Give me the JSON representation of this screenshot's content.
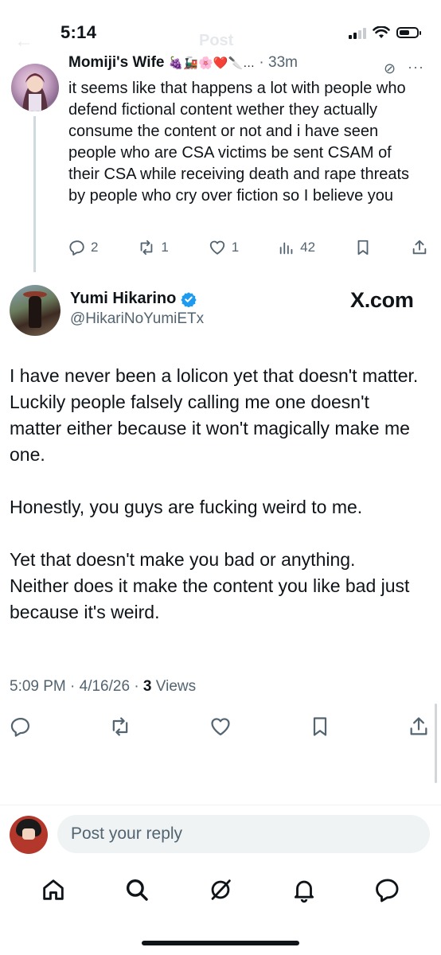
{
  "status_bar": {
    "time": "5:14"
  },
  "header": {
    "title": "Post"
  },
  "parent_tweet": {
    "display_name": "Momiji's Wife",
    "emojis": "🍇🚂🌸❤️🔪…",
    "time": "· 33m",
    "text": "it seems like that happens a lot with people who defend fictional content wether they actually consume the content or not and i have seen people who are CSA victims be sent CSAM of their CSA while receiving death and rape threats by people who cry over fiction so I believe you",
    "replies": "2",
    "reposts": "1",
    "likes": "1",
    "views": "42"
  },
  "main_tweet": {
    "display_name": "Yumi Hikarino",
    "handle": "@HikariNoYumiETx",
    "watermark": "X.com",
    "text": "I have never been a lolicon yet that doesn't matter.\nLuckily people falsely calling me one doesn't matter either because it won't magically make me one.\n\nHonestly, you guys are fucking weird to me.\n\nYet that doesn't make you bad or anything.\nNeither does it make the content you like bad just because it's weird.",
    "timestamp": "5:09 PM · 4/16/26 · ",
    "views_count": "3",
    "views_label": " Views"
  },
  "reply_bar": {
    "placeholder": "Post your reply"
  },
  "bottom_nav": [
    "home-icon",
    "search-icon",
    "grok-icon",
    "notifications-icon",
    "messages-icon"
  ],
  "colors": {
    "text": "#0f1419",
    "secondary": "#536471",
    "verified": "#1d9bf0"
  }
}
